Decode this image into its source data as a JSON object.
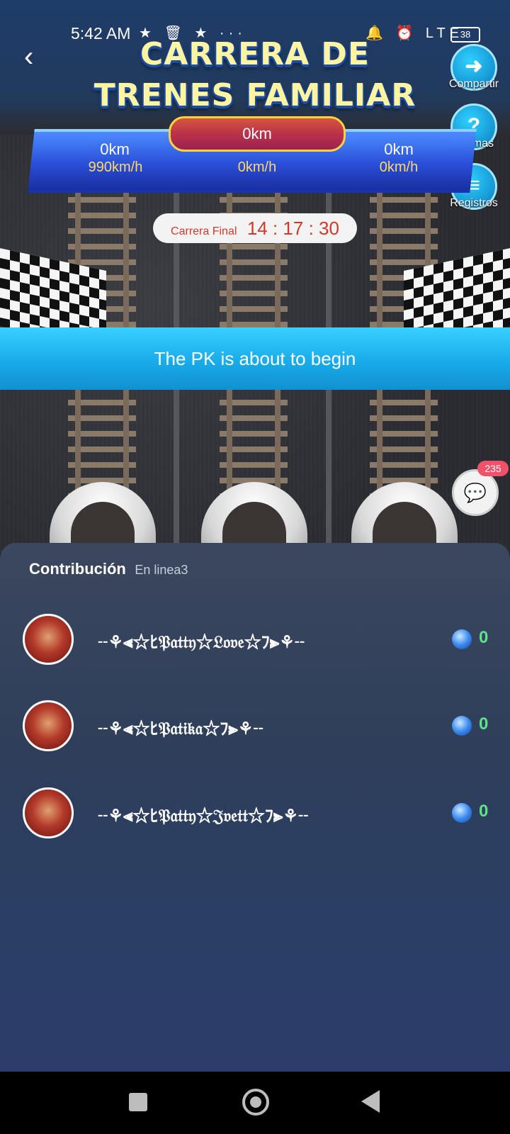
{
  "status_bar": {
    "time": "5:42 AM",
    "left_icons": "★ 🗑 ★ ···",
    "right_icons": "🔔 ⏰ LTE",
    "battery": "38"
  },
  "header": {
    "title_line1": "CARRERA DE",
    "title_line2": "TRENES FAMILIAR"
  },
  "side_buttons": [
    {
      "label": "Compartir",
      "icon": "share-icon",
      "glyph": "➜"
    },
    {
      "label": "Normas",
      "icon": "question-icon",
      "glyph": "?"
    },
    {
      "label": "Registros",
      "icon": "records-icon",
      "glyph": "≡"
    }
  ],
  "scoreboard": {
    "center_km": "0km",
    "lanes": [
      {
        "km": "0km",
        "speed": "990km/h"
      },
      {
        "km": "",
        "speed": "0km/h"
      },
      {
        "km": "0km",
        "speed": "0km/h"
      }
    ]
  },
  "timer": {
    "label": "Carrera Final",
    "value": "14 : 17 : 30"
  },
  "banner": {
    "text": "The PK is about to begin"
  },
  "chat": {
    "badge": "235"
  },
  "contribution": {
    "title": "Contribución",
    "subtitle": "En linea3",
    "users": [
      {
        "name": "╌⚘⫷☆ﾋ𝔓𝔞𝔱𝔱𝔶☆𝔏𝔬𝔳𝔢☆ﾌ⫸⚘╌",
        "score": "0"
      },
      {
        "name": "╌⚘⫷☆ﾋ𝔓𝔞𝔱𝔦𝔨𝔞☆ﾌ⫸⚘╌",
        "score": "0"
      },
      {
        "name": "╌⚘⫷☆ﾋ𝔓𝔞𝔱𝔱𝔶☆𝔍𝔳𝔢𝔱𝔱☆ﾌ⫸⚘╌",
        "score": "0"
      }
    ]
  },
  "colors": {
    "title_yellow": "#fff5a0",
    "banner_blue": "#16a8e8",
    "timer_red": "#d03a2c",
    "score_green": "#5fe08a"
  }
}
